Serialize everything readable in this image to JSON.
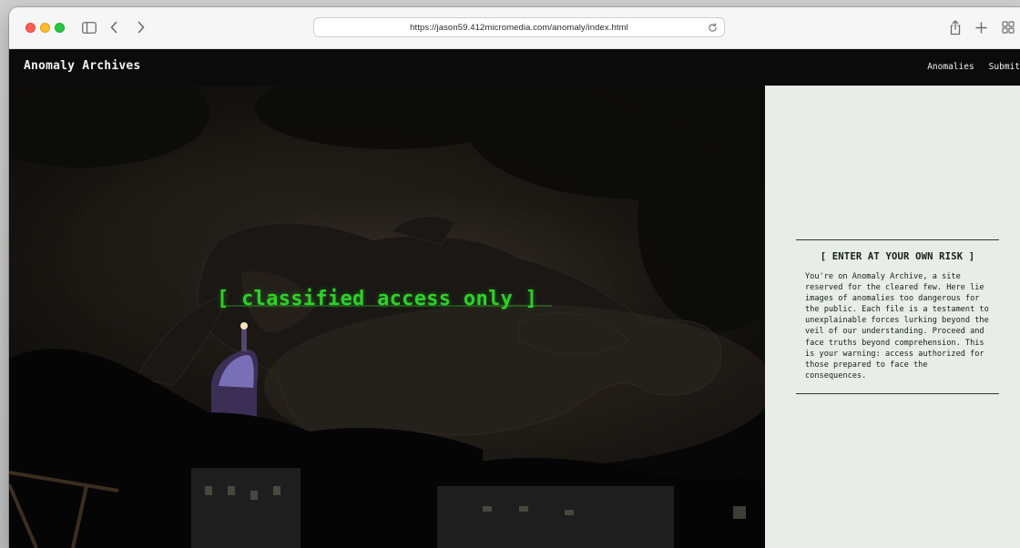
{
  "browser": {
    "url": "https://jason59.412micromedia.com/anomaly/index.html"
  },
  "site": {
    "title": "Anomaly Archives",
    "nav": [
      {
        "label": "Anomalies"
      },
      {
        "label": "Submit"
      }
    ]
  },
  "hero": {
    "heading": "[ classified access only ]",
    "accent_color": "#2ed12a"
  },
  "notice": {
    "heading": "[ ENTER AT YOUR OWN RISK ]",
    "body": "You're on Anomaly Archive, a site reserved for the cleared few. Here lie images of anomalies too dangerous for the public. Each file is a testament to unexplainable forces lurking beyond the veil of our understanding. Proceed and face truths beyond comprehension. This is your warning: access authorized for those prepared to face the consequences."
  },
  "icons": {
    "sidebar": "sidebar-icon",
    "back": "chevron-left-icon",
    "forward": "chevron-right-icon",
    "reload": "reload-icon",
    "share": "share-icon",
    "new_tab": "plus-icon",
    "tabs": "grid-icon"
  }
}
